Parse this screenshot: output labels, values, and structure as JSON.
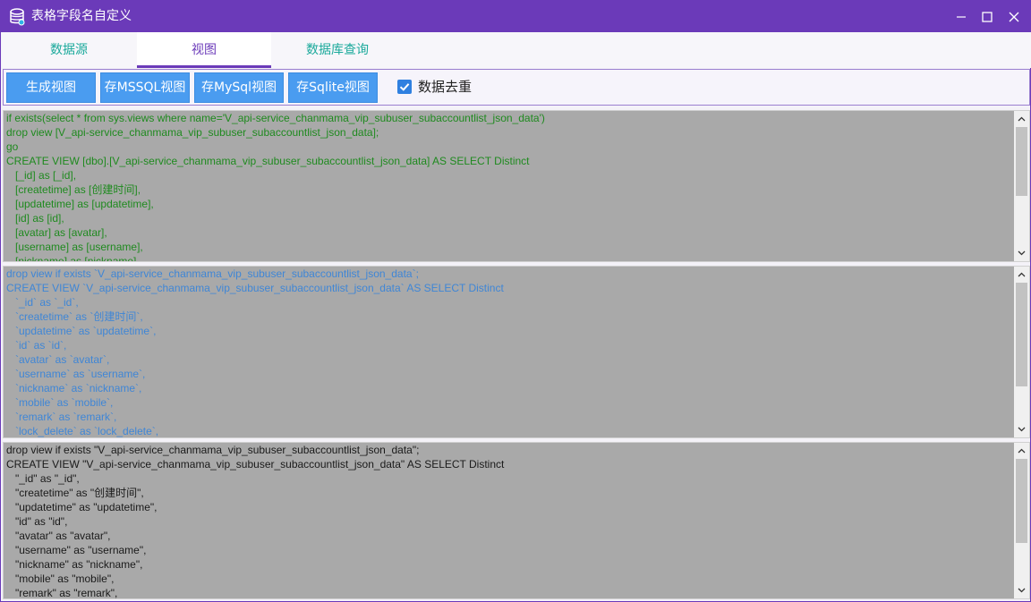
{
  "window": {
    "title": "表格字段名自定义",
    "accent": "#6b3ab9"
  },
  "tabs": [
    {
      "label": "数据源",
      "active": false
    },
    {
      "label": "视图",
      "active": true
    },
    {
      "label": "数据库查询",
      "active": false
    }
  ],
  "toolbar": {
    "generate_label": "生成视图",
    "mssql_label": "存MSSQL视图",
    "mysql_label": "存MySql视图",
    "sqlite_label": "存Sqlite视图",
    "dedupe_label": "数据去重",
    "dedupe_checked": true
  },
  "mssql": {
    "color": "#1f8a1f",
    "lines": [
      "if exists(select * from sys.views where name='V_api-service_chanmama_vip_subuser_subaccountlist_json_data')",
      "drop view [V_api-service_chanmama_vip_subuser_subaccountlist_json_data];",
      "go",
      "CREATE VIEW [dbo].[V_api-service_chanmama_vip_subuser_subaccountlist_json_data] AS SELECT Distinct",
      "   [_id] as [_id],",
      "   [createtime] as [创建时间],",
      "   [updatetime] as [updatetime],",
      "   [id] as [id],",
      "   [avatar] as [avatar],",
      "   [username] as [username],",
      "   [nickname] as [nickname],"
    ]
  },
  "mysql": {
    "color": "#3f86d6",
    "lines": [
      "drop view if exists `V_api-service_chanmama_vip_subuser_subaccountlist_json_data`;",
      "CREATE VIEW `V_api-service_chanmama_vip_subuser_subaccountlist_json_data` AS SELECT Distinct",
      "   `_id` as `_id`,",
      "   `createtime` as `创建时间`,",
      "   `updatetime` as `updatetime`,",
      "   `id` as `id`,",
      "   `avatar` as `avatar`,",
      "   `username` as `username`,",
      "   `nickname` as `nickname`,",
      "   `mobile` as `mobile`,",
      "   `remark` as `remark`,",
      "   `lock_delete` as `lock_delete`,"
    ]
  },
  "sqlite": {
    "color": "#1a1a1a",
    "lines": [
      "drop view if exists \"V_api-service_chanmama_vip_subuser_subaccountlist_json_data\";",
      "CREATE VIEW \"V_api-service_chanmama_vip_subuser_subaccountlist_json_data\" AS SELECT Distinct",
      "   \"_id\" as \"_id\",",
      "   \"createtime\" as \"创建时间\",",
      "   \"updatetime\" as \"updatetime\",",
      "   \"id\" as \"id\",",
      "   \"avatar\" as \"avatar\",",
      "   \"username\" as \"username\",",
      "   \"nickname\" as \"nickname\",",
      "   \"mobile\" as \"mobile\",",
      "   \"remark\" as \"remark\","
    ]
  },
  "icons": {
    "app": "database-icon",
    "minimize": "minimize-icon",
    "maximize": "maximize-icon",
    "close": "close-icon",
    "check": "checkmark-icon",
    "scroll_up": "chevron-up-icon",
    "scroll_down": "chevron-down-icon"
  }
}
